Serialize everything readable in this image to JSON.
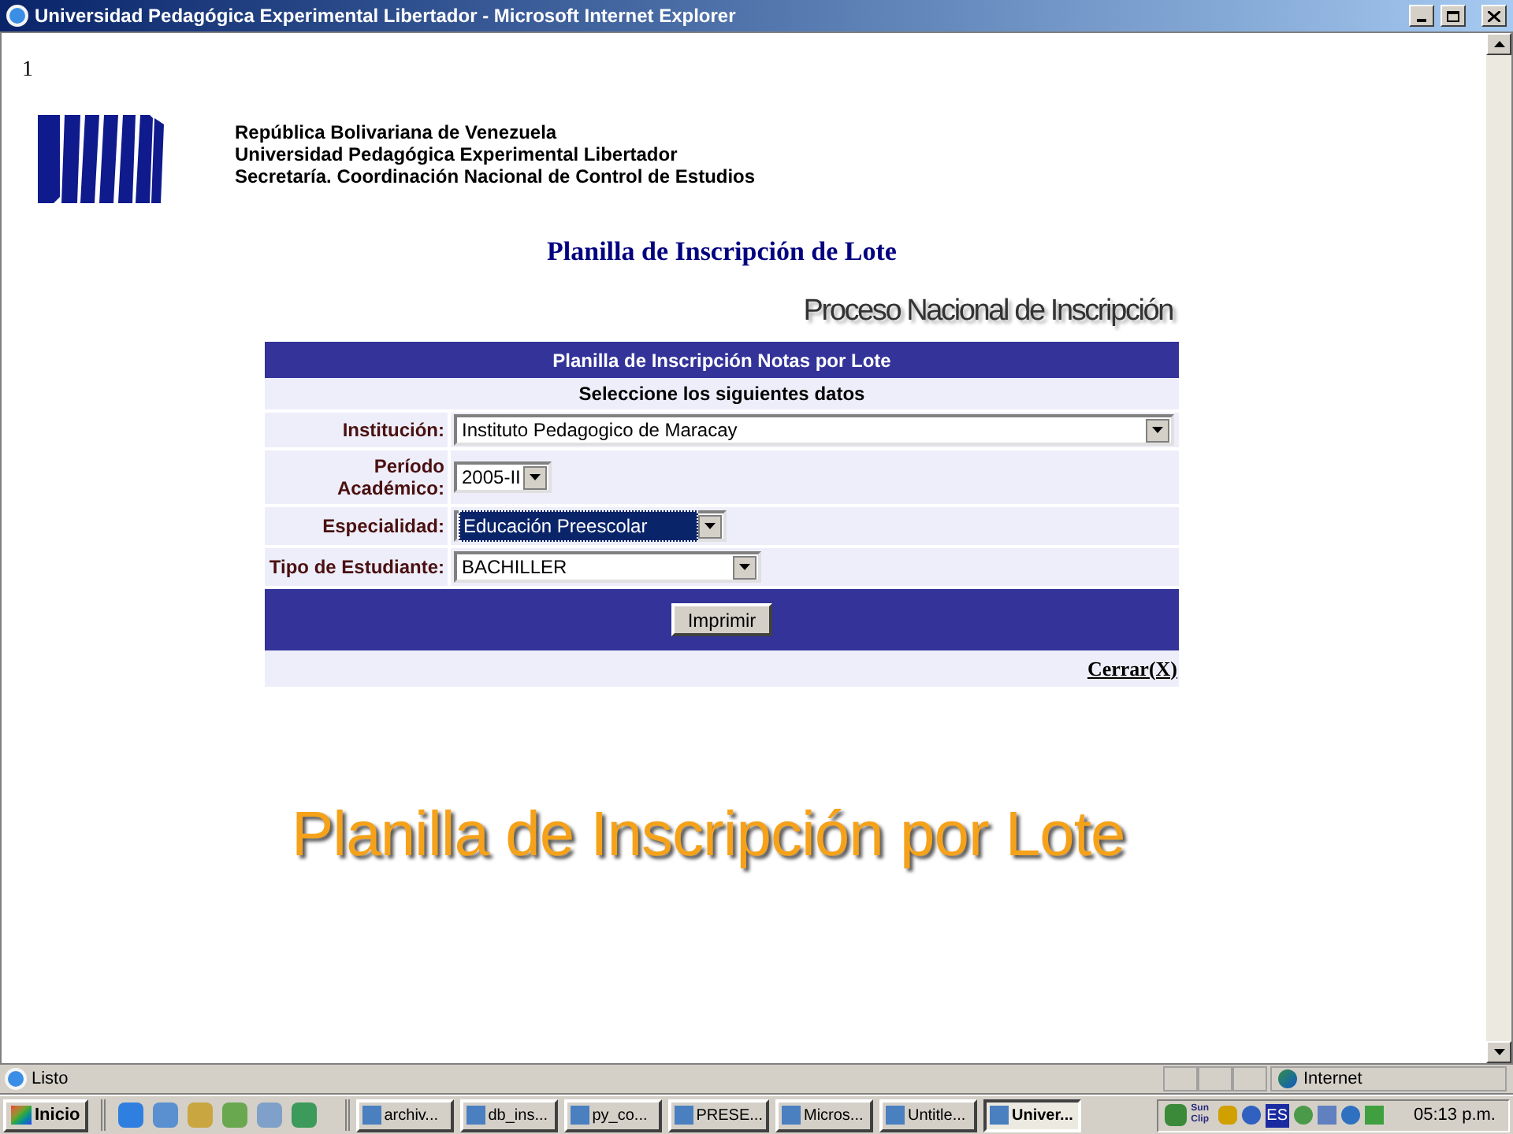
{
  "window": {
    "title": "Universidad Pedagógica Experimental Libertador - Microsoft Internet Explorer"
  },
  "page": {
    "page_number": "1",
    "header_lines": [
      "República Bolivariana de Venezuela",
      "Universidad Pedagógica Experimental Libertador",
      "Secretaría. Coordinación Nacional de Control de Estudios"
    ],
    "heading": "Planilla de Inscripción de Lote",
    "banner": "Proceso Nacional de Inscripción",
    "form": {
      "title": "Planilla de Inscripción Notas por Lote",
      "subtitle": "Seleccione los siguientes datos",
      "fields": [
        {
          "label": "Institución:",
          "value": "Instituto Pedagogico de Maracay",
          "focused": false
        },
        {
          "label": "Período Académico:",
          "value": "2005-II",
          "focused": false
        },
        {
          "label": "Especialidad:",
          "value": "Educación Preescolar",
          "focused": true
        },
        {
          "label": "Tipo de Estudiante:",
          "value": "BACHILLER",
          "focused": false
        }
      ],
      "button": "Imprimir",
      "close_link": "Cerrar(X)"
    },
    "caption": "Planilla de Inscripción por Lote"
  },
  "status_bar": {
    "text": "Listo",
    "zone": "Internet"
  },
  "taskbar": {
    "start": "Inicio",
    "tasks": [
      {
        "label": "archiv...",
        "selected": false
      },
      {
        "label": "db_ins...",
        "selected": false
      },
      {
        "label": "py_co...",
        "selected": false
      },
      {
        "label": "PRESE...",
        "selected": false
      },
      {
        "label": "Micros...",
        "selected": false
      },
      {
        "label": "Untitle...",
        "selected": false
      },
      {
        "label": "Univer...",
        "selected": true
      }
    ],
    "tray_labels": [
      "Sun Clip",
      "ES"
    ],
    "clock": "05:13 p.m."
  }
}
